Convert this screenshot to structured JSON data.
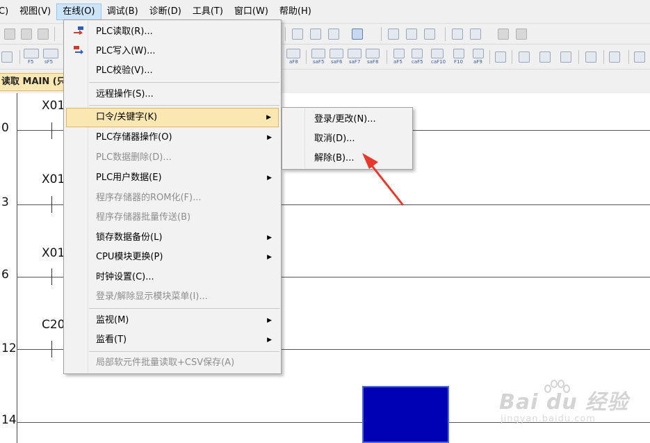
{
  "menubar": {
    "items": [
      {
        "label": "C)",
        "active": false
      },
      {
        "label": "视图(V)",
        "active": false
      },
      {
        "label": "在线(O)",
        "active": true
      },
      {
        "label": "调试(B)",
        "active": false
      },
      {
        "label": "诊断(D)",
        "active": false
      },
      {
        "label": "工具(T)",
        "active": false
      },
      {
        "label": "窗口(W)",
        "active": false
      },
      {
        "label": "帮助(H)",
        "active": false
      }
    ]
  },
  "toolbar2": {
    "labels": [
      "F5",
      "sF5",
      "aF8",
      "saF5",
      "saF6",
      "saF7",
      "saF8",
      "aF5",
      "caF5",
      "caF10",
      "F10",
      "aF9"
    ]
  },
  "tab": {
    "title": "读取 MAIN (只"
  },
  "ladder": {
    "rungs": [
      {
        "step": "0",
        "device": "X01"
      },
      {
        "step": "3",
        "device": "X01"
      },
      {
        "step": "6",
        "device": "X01"
      },
      {
        "step": "12",
        "device": "C20"
      },
      {
        "step": "14",
        "device": ""
      }
    ]
  },
  "online_menu": {
    "items": [
      {
        "label": "PLC读取(R)...",
        "disabled": false,
        "submenu": false,
        "icon": "plc-read-icon"
      },
      {
        "label": "PLC写入(W)...",
        "disabled": false,
        "submenu": false,
        "icon": "plc-write-icon"
      },
      {
        "label": "PLC校验(V)...",
        "disabled": false,
        "submenu": false,
        "icon": ""
      },
      {
        "label": "远程操作(S)...",
        "disabled": false,
        "submenu": false,
        "icon": ""
      },
      {
        "label": "口令/关键字(K)",
        "disabled": false,
        "submenu": true,
        "highlighted": true,
        "icon": ""
      },
      {
        "label": "PLC存储器操作(O)",
        "disabled": false,
        "submenu": true,
        "icon": ""
      },
      {
        "label": "PLC数据删除(D)...",
        "disabled": true,
        "submenu": false,
        "icon": ""
      },
      {
        "label": "PLC用户数据(E)",
        "disabled": false,
        "submenu": true,
        "icon": ""
      },
      {
        "label": "程序存储器的ROM化(F)...",
        "disabled": true,
        "submenu": false,
        "icon": ""
      },
      {
        "label": "程序存储器批量传送(B)",
        "disabled": true,
        "submenu": false,
        "icon": ""
      },
      {
        "label": "锁存数据备份(L)",
        "disabled": false,
        "submenu": true,
        "icon": ""
      },
      {
        "label": "CPU模块更换(P)",
        "disabled": false,
        "submenu": true,
        "icon": ""
      },
      {
        "label": "时钟设置(C)...",
        "disabled": false,
        "submenu": false,
        "icon": ""
      },
      {
        "label": "登录/解除显示模块菜单(I)...",
        "disabled": true,
        "submenu": false,
        "icon": ""
      },
      {
        "label": "监视(M)",
        "disabled": false,
        "submenu": true,
        "icon": ""
      },
      {
        "label": "监看(T)",
        "disabled": false,
        "submenu": true,
        "icon": ""
      },
      {
        "label": "局部软元件批量读取+CSV保存(A)",
        "disabled": true,
        "submenu": false,
        "icon": ""
      }
    ]
  },
  "password_submenu": {
    "items": [
      {
        "label": "登录/更改(N)..."
      },
      {
        "label": "取消(D)..."
      },
      {
        "label": "解除(B)..."
      }
    ]
  },
  "watermark": {
    "main": "Bai du 经验",
    "sub": "jingyan.baidu.com"
  },
  "colors": {
    "menu_highlight": "#fbe7b2",
    "menu_highlight_border": "#e2b756",
    "coil_fill": "#0000b4",
    "annotation_arrow": "#e8392c"
  }
}
